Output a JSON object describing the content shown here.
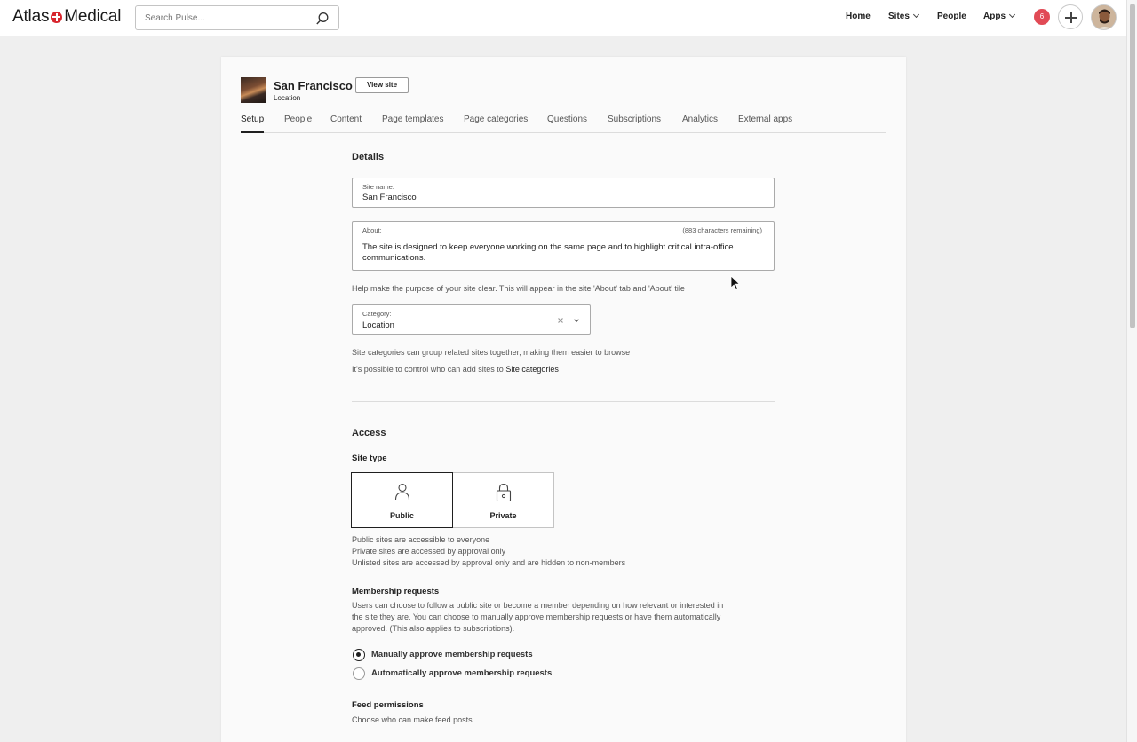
{
  "brand": {
    "left": "Atlas",
    "right": "Medical"
  },
  "search": {
    "placeholder": "Search Pulse..."
  },
  "nav": {
    "home": "Home",
    "sites": "Sites",
    "people": "People",
    "apps": "Apps"
  },
  "notifications": {
    "count": "6"
  },
  "site": {
    "title": "San Francisco",
    "subtitle": "Location",
    "view_label": "View site"
  },
  "tabs": [
    "Setup",
    "People",
    "Content",
    "Page templates",
    "Page categories",
    "Questions",
    "Subscriptions",
    "Analytics",
    "External apps"
  ],
  "details": {
    "heading": "Details",
    "site_name_label": "Site name:",
    "site_name_value": "San Francisco",
    "about_label": "About:",
    "about_remaining": "(883 characters remaining)",
    "about_line1": "The site is designed to keep everyone working on the same page and to highlight critical intra-office",
    "about_line2": "communications.",
    "about_help": "Help make the purpose of your site clear. This will appear in the site 'About' tab and 'About' tile",
    "category_label": "Category:",
    "category_value": "Location",
    "category_help": "Site categories can group related sites together, making them easier to browse",
    "category_control_prefix": "It's possible to control who can add sites to ",
    "category_control_link": "Site categories"
  },
  "access": {
    "heading": "Access",
    "site_type_label": "Site type",
    "types": [
      "Public",
      "Private"
    ],
    "selected_type": "Public",
    "type_help": [
      "Public sites are accessible to everyone",
      "Private sites are accessed by approval only",
      "Unlisted sites are accessed by approval only and are hidden to non-members"
    ],
    "membership_heading": "Membership requests",
    "membership_text": [
      "Users can choose to follow a public site or become a member depending on how relevant or interested in",
      "the site they are. You can choose to manually approve membership requests or have them automatically",
      "approved. (This also applies to subscriptions)."
    ],
    "membership_options": [
      "Manually approve membership requests",
      "Automatically approve membership requests"
    ],
    "membership_selected": "Manually approve membership requests",
    "feed_heading": "Feed permissions",
    "feed_text": "Choose who can make feed posts"
  }
}
